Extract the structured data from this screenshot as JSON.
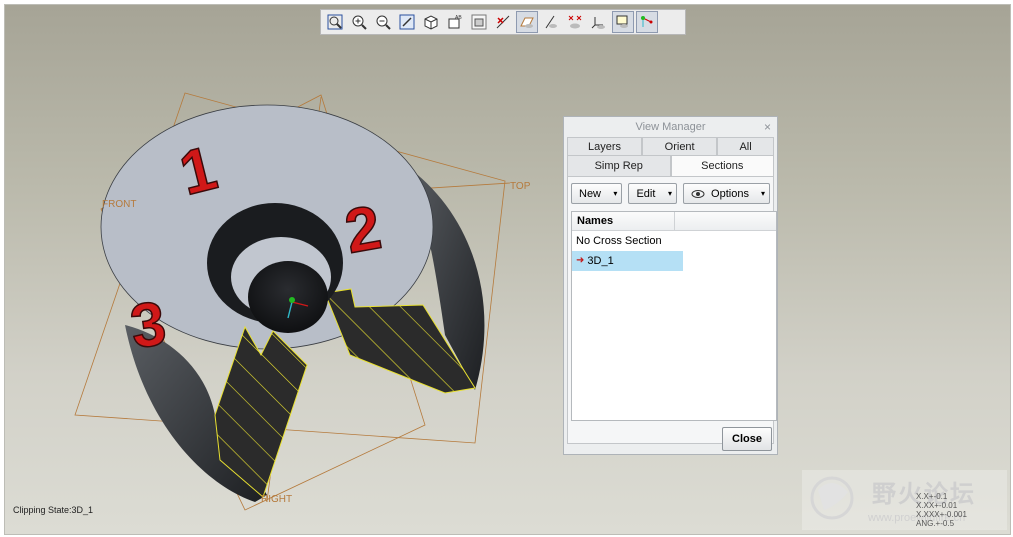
{
  "toolbar": {
    "buttons": [
      {
        "icon": "refit-icon"
      },
      {
        "icon": "zoom-in-icon"
      },
      {
        "icon": "zoom-out-icon"
      },
      {
        "icon": "repaint-icon"
      },
      {
        "icon": "display-style-icon"
      },
      {
        "icon": "saved-orientations-icon"
      },
      {
        "icon": "view-manager-icon"
      },
      {
        "icon": "datum-display-icon"
      },
      {
        "icon": "plane-display-icon"
      },
      {
        "icon": "axis-display-icon"
      },
      {
        "icon": "point-display-icon"
      },
      {
        "icon": "csys-display-icon"
      },
      {
        "icon": "annotation-display-icon"
      },
      {
        "icon": "spin-center-icon"
      }
    ]
  },
  "viewport": {
    "plane_labels": {
      "front": "FRONT",
      "top": "TOP",
      "right": "RIGHT"
    },
    "model_numbers": [
      "1",
      "2",
      "3"
    ],
    "clipping_state": "Clipping State:3D_1",
    "tolerances": [
      "X.X+-0.1",
      "X.XX+-0.01",
      "X.XXX+-0.001",
      "ANG.+-0.5"
    ]
  },
  "view_manager": {
    "title": "View Manager",
    "close_symbol": "×",
    "tabs_row1": [
      "Layers",
      "Orient",
      "All"
    ],
    "tabs_row2": [
      "Simp Rep",
      "Sections"
    ],
    "selected_tab": "Sections",
    "buttons": {
      "new": "New",
      "edit": "Edit",
      "options": "Options",
      "dropdown_symbol": "▾"
    },
    "list_header": "Names",
    "list_items": [
      "No Cross Section",
      "3D_1"
    ],
    "active_item": "3D_1",
    "close_label": "Close"
  },
  "watermark": {
    "text": "野火论坛",
    "url": "www.proewildfire.cn"
  },
  "colors": {
    "section_hatch": "#2b2b2b",
    "hatch_line": "#e8e030",
    "datum_plane": "#b57a3c",
    "number_red": "#d01818",
    "model_face": "#b8bec8",
    "selected_row": "#b5e0f5"
  }
}
